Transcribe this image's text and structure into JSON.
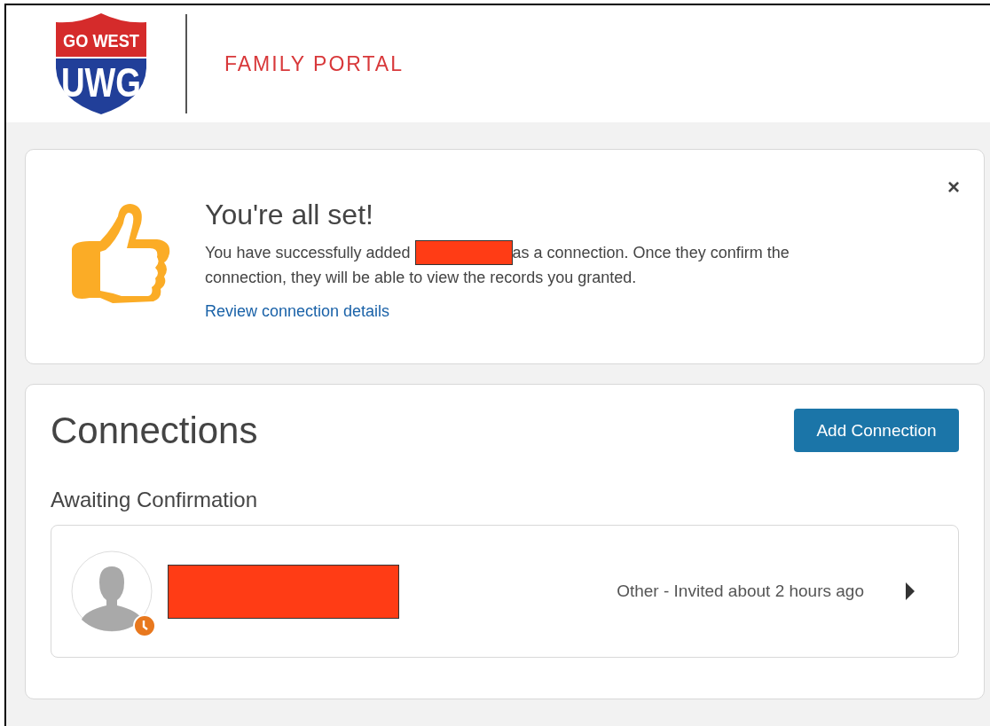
{
  "header": {
    "logo": {
      "top_text": "GO WEST",
      "main_text": "UWG"
    },
    "title": "FAMILY PORTAL"
  },
  "alert": {
    "title": "You're all set!",
    "message_start": "You have successfully added ",
    "message_end": "as a connection. Once they confirm the",
    "message_line_2": "connection, they will be able to view the records you granted.",
    "link": "Review connection details",
    "close": "×"
  },
  "connections": {
    "title": "Connections",
    "button": "Add Connection",
    "section_title": "Awaiting Confirmation",
    "items": [
      {
        "status": "Other - Invited about 2 hours ago"
      }
    ]
  }
}
